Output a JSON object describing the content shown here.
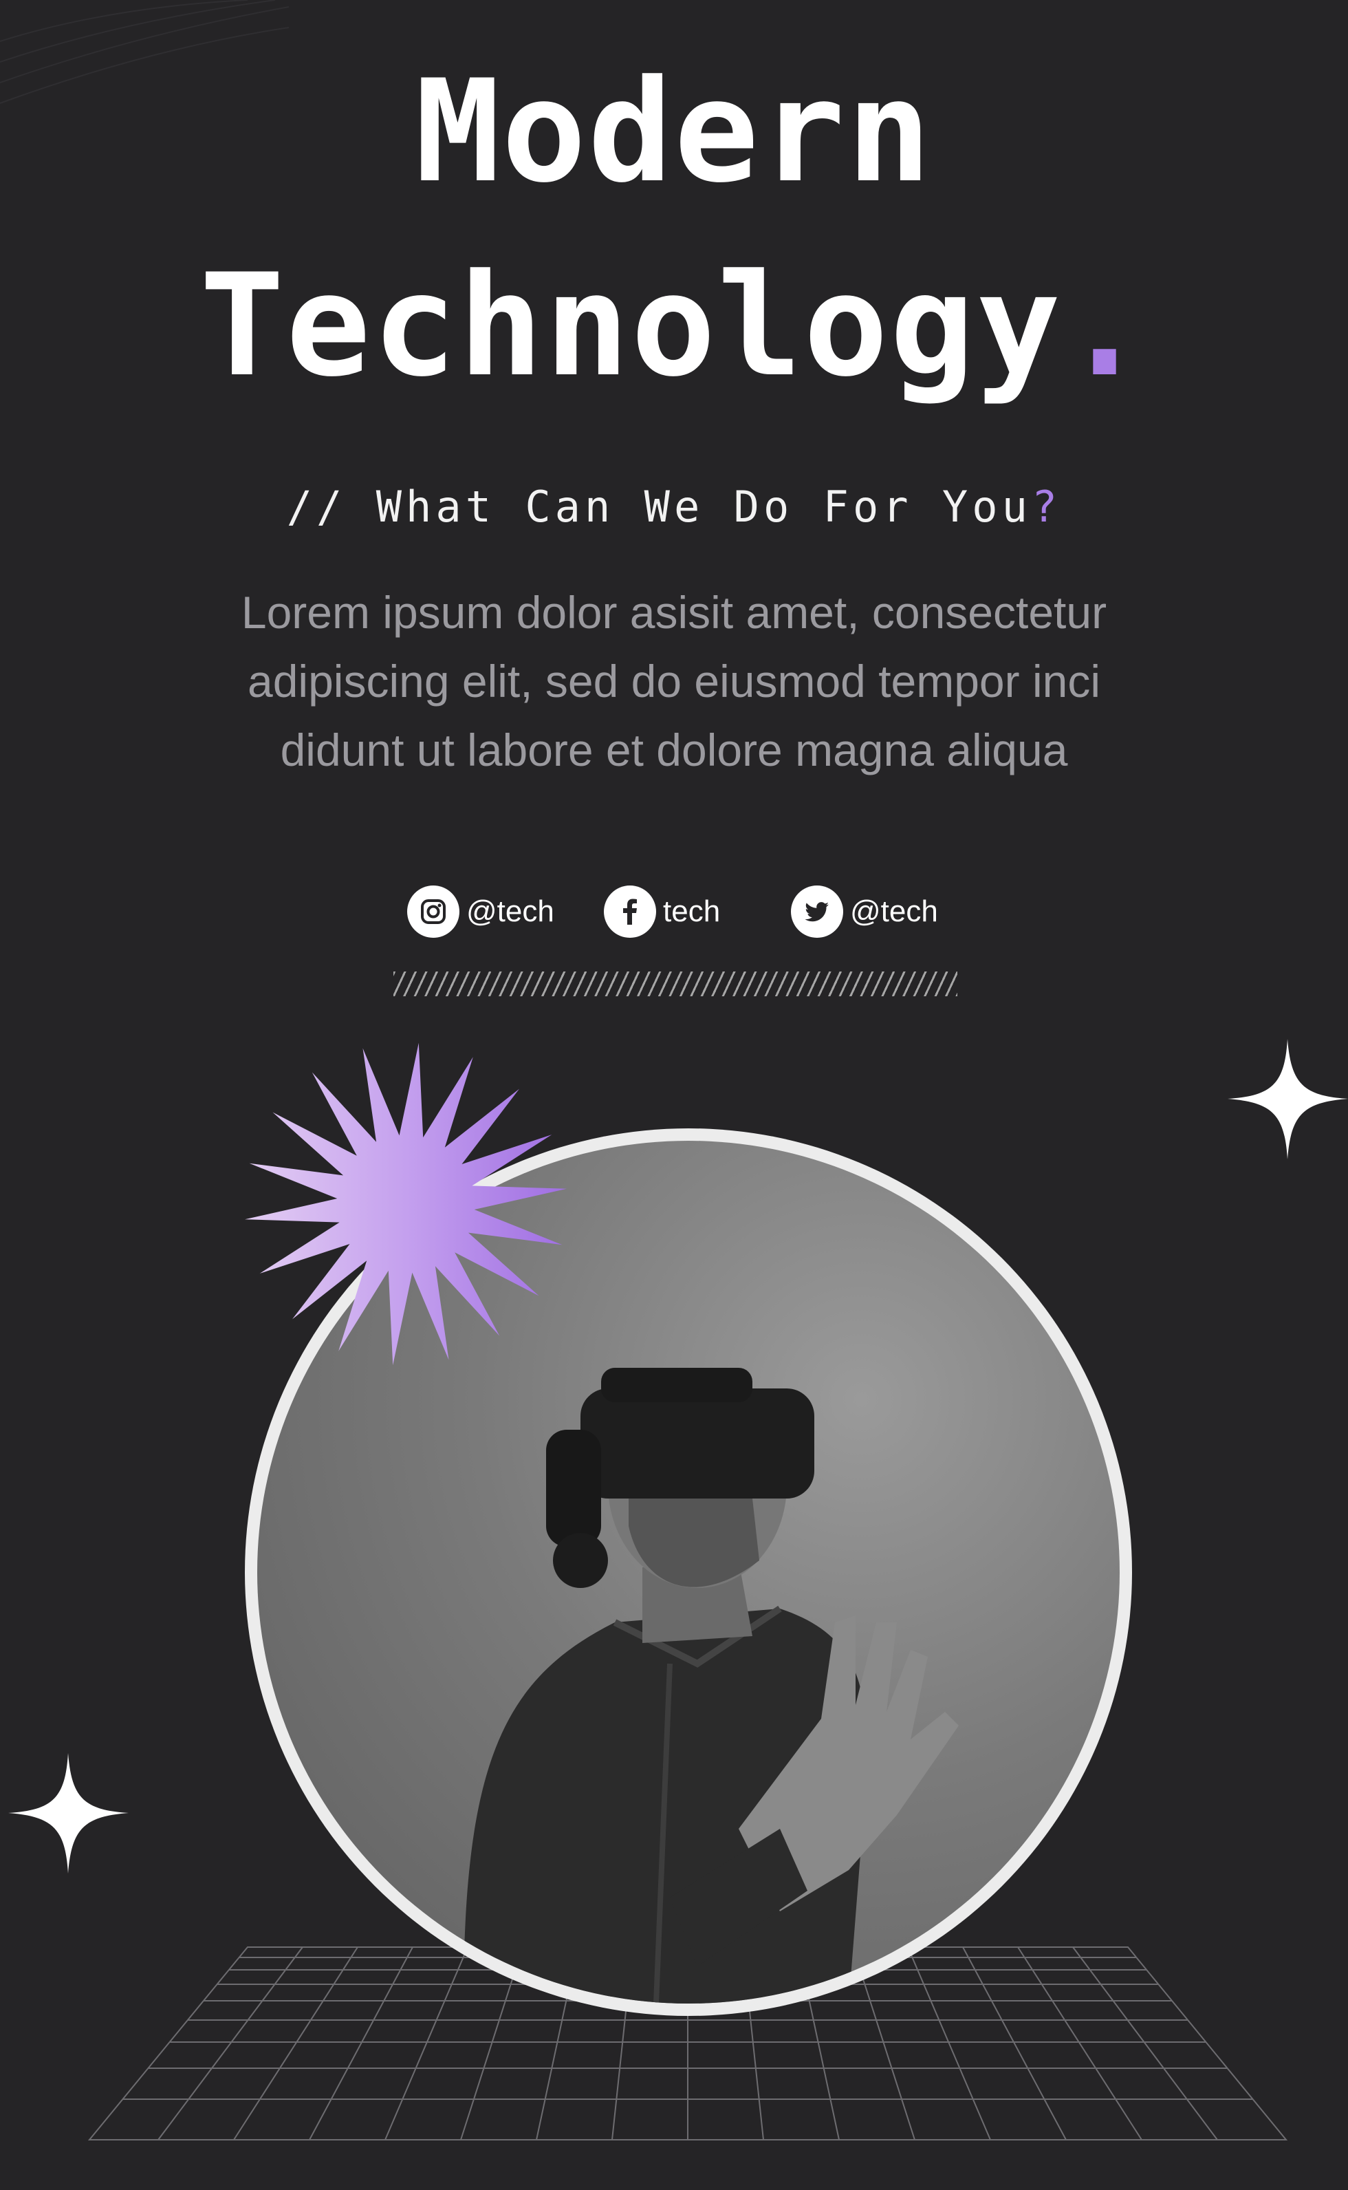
{
  "title": {
    "line1": "Modern",
    "line2": "Technology",
    "dot": "."
  },
  "subtitle": {
    "text": "// What Can We Do For You",
    "accent": "?"
  },
  "body": {
    "line1": "Lorem ipsum dolor asisit amet, consectetur",
    "line2": "adipiscing elit, sed do eiusmod tempor inci",
    "line3": "didunt ut labore et dolore magna aliqua"
  },
  "socials": [
    {
      "icon": "instagram-icon",
      "label": "@tech"
    },
    {
      "icon": "facebook-icon",
      "label": "tech"
    },
    {
      "icon": "twitter-icon",
      "label": "@tech"
    }
  ],
  "colors": {
    "background": "#252426",
    "accent": "#a97ee6",
    "text": "#ffffff",
    "body_text": "#9b9a9f"
  }
}
